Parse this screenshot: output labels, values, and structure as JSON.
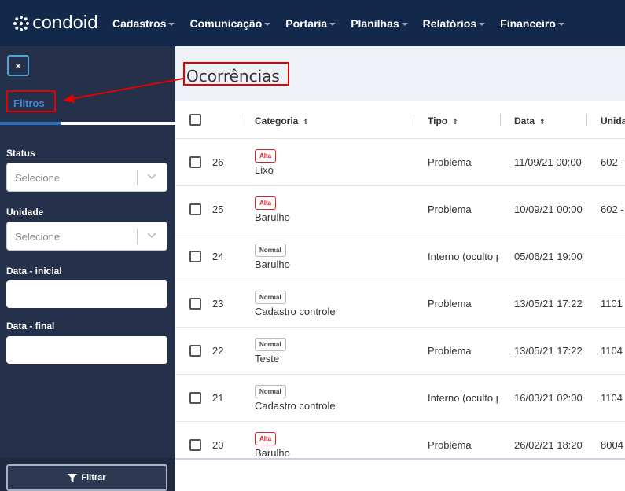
{
  "topbar": {
    "logo": "condoid",
    "nav": [
      {
        "label": "Cadastros"
      },
      {
        "label": "Comunicação"
      },
      {
        "label": "Portaria"
      },
      {
        "label": "Planilhas"
      },
      {
        "label": "Relatórios"
      },
      {
        "label": "Financeiro"
      }
    ]
  },
  "sidebar": {
    "close_label": "×",
    "tab_label": "Filtros",
    "status_label": "Status",
    "status_placeholder": "Selecione",
    "unidade_label": "Unidade",
    "unidade_placeholder": "Selecione",
    "data_inicial_label": "Data - inicial",
    "data_final_label": "Data - final",
    "filter_button": "Filtrar"
  },
  "main": {
    "title": "Ocorrências",
    "columns": [
      "Categoria",
      "Tipo",
      "Data",
      "Unida"
    ],
    "rows": [
      {
        "id": "26",
        "badge": "Alta",
        "categoria": "Lixo",
        "tipo": "Problema",
        "data": "11/09/21 00:00",
        "unidade": "602 -"
      },
      {
        "id": "25",
        "badge": "Alta",
        "categoria": "Barulho",
        "tipo": "Problema",
        "data": "10/09/21 00:00",
        "unidade": "602 -"
      },
      {
        "id": "24",
        "badge": "Normal",
        "categoria": "Barulho",
        "tipo": "Interno (oculto p",
        "data": "05/06/21 19:00",
        "unidade": ""
      },
      {
        "id": "23",
        "badge": "Normal",
        "categoria": "Cadastro controle",
        "tipo": "Problema",
        "data": "13/05/21 17:22",
        "unidade": "1101 -"
      },
      {
        "id": "22",
        "badge": "Normal",
        "categoria": "Teste",
        "tipo": "Problema",
        "data": "13/05/21 17:22",
        "unidade": "1104 -"
      },
      {
        "id": "21",
        "badge": "Normal",
        "categoria": "Cadastro controle",
        "tipo": "Interno (oculto p",
        "data": "16/03/21 02:00",
        "unidade": "1104 -"
      },
      {
        "id": "20",
        "badge": "Alta",
        "categoria": "Barulho",
        "tipo": "Problema",
        "data": "26/02/21 18:20",
        "unidade": "8004"
      }
    ]
  },
  "colors": {
    "topbar": "#13294b",
    "sidebar": "#25304a",
    "annotation": "#e50000",
    "accent": "#2a6fbd"
  }
}
